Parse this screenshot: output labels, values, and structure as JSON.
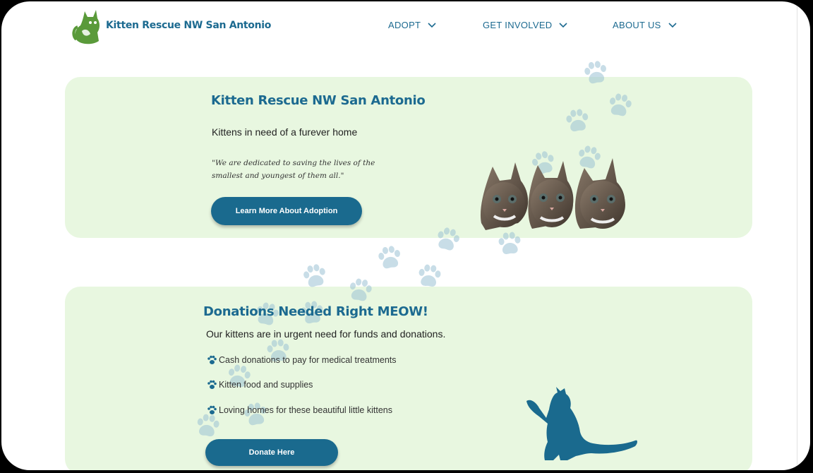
{
  "header": {
    "brand": "Kitten Rescue NW San Antonio",
    "nav": [
      {
        "label": "ADOPT"
      },
      {
        "label": "GET INVOLVED"
      },
      {
        "label": "ABOUT US"
      }
    ]
  },
  "hero": {
    "title": "Kitten Rescue NW San Antonio",
    "subtitle": "Kittens in need of a furever home",
    "quote": "\"We are dedicated to saving the lives of the smallest and youngest of them all.\"",
    "button": "Learn More About Adoption"
  },
  "donations": {
    "title": "Donations Needed Right MEOW!",
    "intro": "Our kittens are in urgent need for funds and donations.",
    "items": [
      "Cash donations to pay for medical treatments",
      "Kitten food and supplies",
      "Loving homes for these beautiful little kittens"
    ],
    "button": "Donate Here"
  },
  "colors": {
    "brand_blue": "#1c6a90",
    "logo_green": "#5a9a3a",
    "card_bg": "#e8f7e0",
    "paw": "#9cc3d5"
  },
  "icons": {
    "logo": "cat-logo-icon",
    "nav_arrow": "chevron-down-icon",
    "bullet": "paw-icon"
  }
}
